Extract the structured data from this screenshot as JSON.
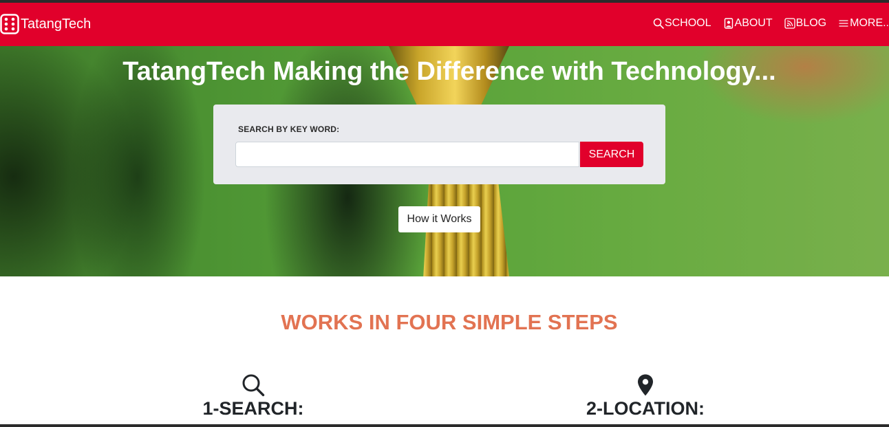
{
  "header": {
    "brand": {
      "name": "TatangTech",
      "icon": "dice-icon"
    },
    "nav": [
      {
        "label": "SCHOOL",
        "icon": "search-icon"
      },
      {
        "label": "ABOUT",
        "icon": "person-badge-icon"
      },
      {
        "label": "BLOG",
        "icon": "rss-icon"
      },
      {
        "label": "MORE..",
        "icon": "menu-icon"
      }
    ]
  },
  "hero": {
    "title": "TatangTech Making the Difference with Technology...",
    "search": {
      "label": "SEARCH BY KEY WORD:",
      "input_value": "",
      "placeholder": "",
      "button_label": "SEARCH"
    },
    "how_it_works_label": "How it Works"
  },
  "steps_section": {
    "heading": "WORKS IN FOUR SIMPLE STEPS",
    "steps": [
      {
        "title": "1-SEARCH:",
        "icon": "search-icon"
      },
      {
        "title": "2-LOCATION:",
        "icon": "location-pin-icon"
      }
    ]
  },
  "colors": {
    "brand_red": "#e1002b",
    "heading_orange": "#e27352",
    "panel_gray": "#e9eaee",
    "text_dark": "#212529"
  }
}
